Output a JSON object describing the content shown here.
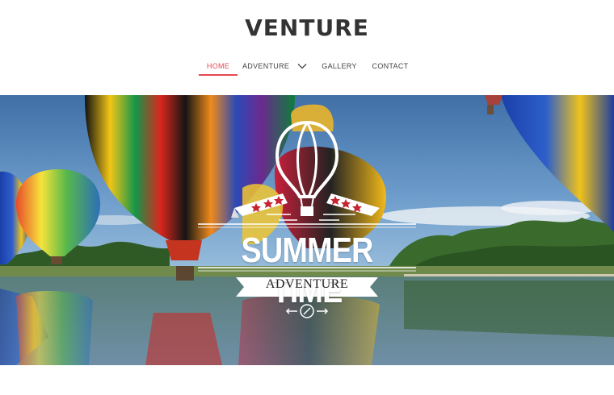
{
  "header": {
    "logo": "VENTURE"
  },
  "nav": {
    "items": [
      {
        "label": "HOME",
        "active": true
      },
      {
        "label": "ADVENTURE",
        "has_dropdown": true
      },
      {
        "label": "GALLERY"
      },
      {
        "label": "CONTACT"
      }
    ]
  },
  "hero": {
    "title": "SUMMER TIME",
    "subtitle": "ADVENTURE",
    "emblem_icon": "hot-air-balloon-icon",
    "scroll_icon": "compass-icon"
  },
  "colors": {
    "accent": "#e8474f",
    "text": "#333333"
  }
}
